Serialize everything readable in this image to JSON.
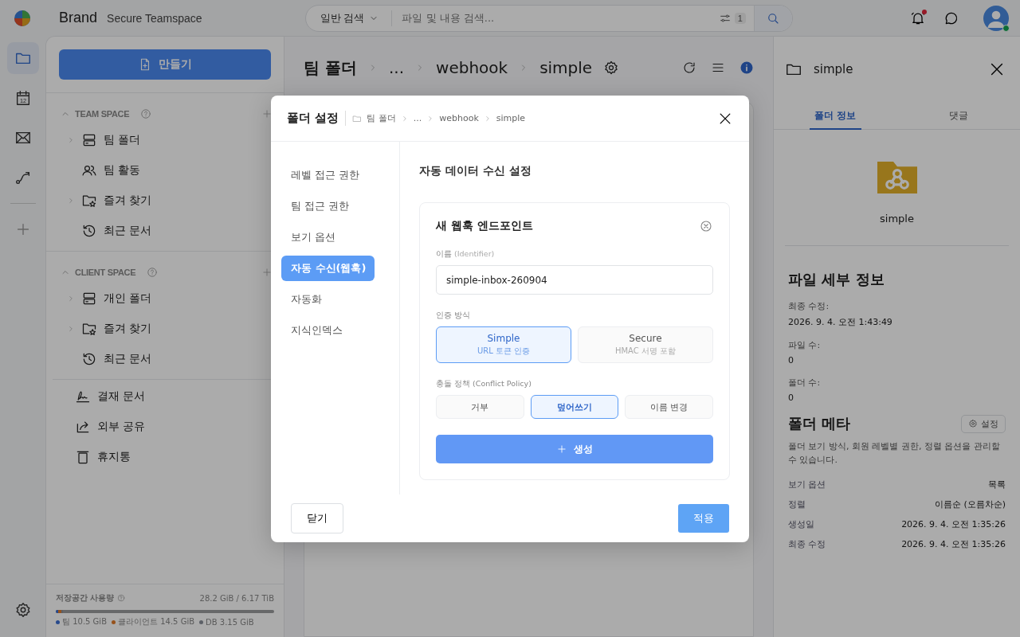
{
  "topbar": {
    "brand": "Brand",
    "subtitle": "Secure Teamspace",
    "search": {
      "mode": "일반 검색",
      "placeholder": "파일 및 내용 검색...",
      "filter_count": "1"
    },
    "notification_unread": true,
    "user_online": true
  },
  "rail": [
    {
      "kind": "folder",
      "selected": true
    },
    {
      "kind": "calendar",
      "selected": false,
      "text": "12"
    },
    {
      "kind": "mail",
      "selected": false
    },
    {
      "kind": "flow",
      "selected": false
    }
  ],
  "sidebar": {
    "create_label": "만들기",
    "sections": [
      {
        "title": "TEAM SPACE",
        "expanded": true,
        "items": [
          {
            "label": "팀 폴더",
            "kind": "drive",
            "expandable": true
          },
          {
            "label": "팀 활동",
            "kind": "people",
            "expandable": false
          },
          {
            "label": "즐겨 찾기",
            "kind": "star-folder",
            "expandable": true
          },
          {
            "label": "최근 문서",
            "kind": "history",
            "expandable": false
          }
        ]
      },
      {
        "title": "CLIENT SPACE",
        "expanded": true,
        "items": [
          {
            "label": "개인 폴더",
            "kind": "drive",
            "expandable": true
          },
          {
            "label": "즐겨 찾기",
            "kind": "star-folder",
            "expandable": true
          },
          {
            "label": "최근 문서",
            "kind": "history",
            "expandable": false
          }
        ]
      }
    ],
    "extra_items": [
      {
        "label": "결재 문서",
        "kind": "sign"
      },
      {
        "label": "외부 공유",
        "kind": "share"
      },
      {
        "label": "휴지통",
        "kind": "trash"
      }
    ],
    "storage": {
      "title": "저장공간 사용량",
      "total": "28.2 GiB / 6.17 TiB",
      "segments": [
        {
          "label": "팀 10.5 GiB",
          "color": "#284a8c",
          "level": 0.012
        },
        {
          "label": "클라이언트 14.5 GiB",
          "color": "#96521c",
          "level": 0.014
        },
        {
          "label": "DB 3.15 GiB",
          "color": "#5c6067",
          "level": 0.006
        }
      ]
    }
  },
  "main": {
    "breadcrumb": [
      "팀 폴더",
      "...",
      "webhook",
      "simple"
    ]
  },
  "modal": {
    "title": "폴더 설정",
    "breadcrumb": [
      "팀 폴더",
      "...",
      "webhook",
      "simple"
    ],
    "nav": [
      {
        "label": "레벨 접근 권한",
        "selected": false
      },
      {
        "label": "팀 접근 권한",
        "selected": false
      },
      {
        "label": "보기 옵션",
        "selected": false
      },
      {
        "label": "자동 수신(웹훅)",
        "selected": true
      },
      {
        "label": "자동화",
        "selected": false
      },
      {
        "label": "지식인덱스",
        "selected": false
      }
    ],
    "heading": "자동 데이터 수신 설정",
    "card": {
      "title": "새 웹훅 엔드포인트",
      "name_label": "이름 ",
      "name_hint": "(Identifier)",
      "name_value": "simple-inbox-260904",
      "auth_label": "인증 방식",
      "auth_options": [
        {
          "label": "Simple",
          "sub": "URL 토큰 인증",
          "selected": true
        },
        {
          "label": "Secure",
          "sub": "HMAC 서명 포함",
          "selected": false
        }
      ],
      "policy_label": "충돌 정책 (Conflict Policy)",
      "policy_options": [
        {
          "label": "거부",
          "selected": false
        },
        {
          "label": "덮어쓰기",
          "selected": true
        },
        {
          "label": "이름 변경",
          "selected": false
        }
      ],
      "create_label": "생성"
    },
    "close_label": "닫기",
    "apply_label": "적용"
  },
  "panel": {
    "title": "simple",
    "tabs": [
      {
        "label": "폴더 정보",
        "selected": true
      },
      {
        "label": "댓글",
        "selected": false
      }
    ],
    "folder_name": "simple",
    "details_title": "파일 세부 정보",
    "details": [
      {
        "label": "최종 수정:",
        "value": "2026. 9. 4. 오전 1:43:49"
      },
      {
        "label": "파일 수:",
        "value": "0"
      },
      {
        "label": "폴더 수:",
        "value": "0"
      }
    ],
    "meta_title": "폴더 메타",
    "meta_button": "설정",
    "meta_desc": "폴더 보기 방식, 회원 레벨별 권한, 정렬 옵션을 관리할 수 있습니다.",
    "meta_rows": [
      {
        "label": "보기 옵션",
        "value": "목록"
      },
      {
        "label": "정렬",
        "value": "이름순 (오름차순)"
      },
      {
        "label": "생성일",
        "value": "2026. 9. 4. 오전 1:35:26"
      },
      {
        "label": "최종 수정",
        "value": "2026. 9. 4. 오전 1:35:26"
      }
    ]
  }
}
